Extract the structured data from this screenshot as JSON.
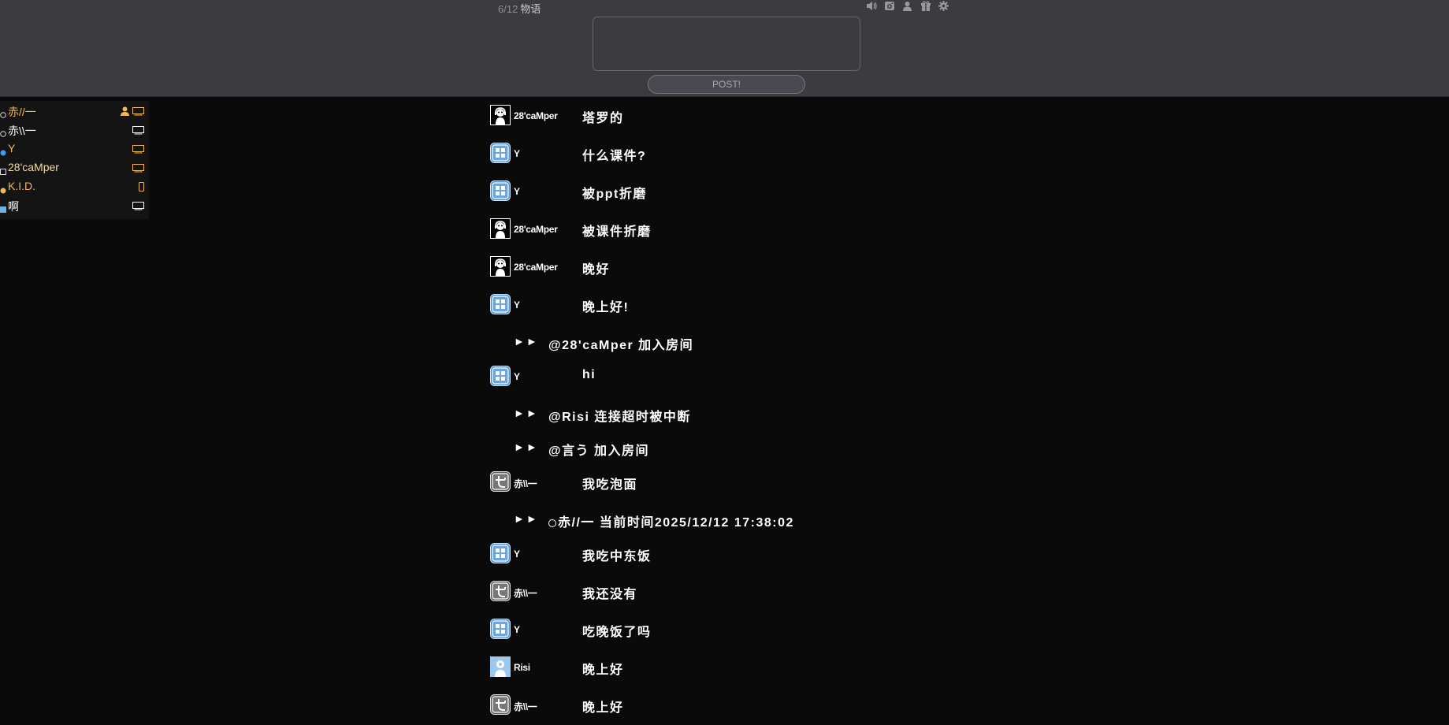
{
  "room": {
    "count": "6/12",
    "name": "物语"
  },
  "composer": {
    "placeholder": "",
    "post_label": "POST!"
  },
  "top_icons": [
    "speaker-icon",
    "camera-icon",
    "person-icon",
    "gift-icon",
    "gear-icon"
  ],
  "users": [
    {
      "name": "赤//一",
      "color": "#f2b857",
      "mark": "ring",
      "icons": [
        "user-host-icon",
        "monitor-icon"
      ]
    },
    {
      "name": "赤\\\\一",
      "color": "#ffffff",
      "mark": "ring",
      "icons": [
        "monitor-icon"
      ]
    },
    {
      "name": "Y",
      "color": "#f2b857",
      "mark": "dot-blue",
      "icons": [
        "monitor-icon"
      ]
    },
    {
      "name": "28'caMper",
      "color": "#f1d9a6",
      "mark": "square",
      "icons": [
        "monitor-icon"
      ]
    },
    {
      "name": "K.I.D.",
      "color": "#f2b857",
      "mark": "dot-orange",
      "icons": [
        "phone-icon"
      ]
    },
    {
      "name": "啊",
      "color": "#ffffff",
      "mark": "square-blue",
      "icons": [
        "monitor-icon"
      ]
    }
  ],
  "messages": [
    {
      "type": "msg",
      "avatar": "camper",
      "sender": "28'caMper",
      "text": "塔罗的"
    },
    {
      "type": "msg",
      "avatar": "grid",
      "sender": "Y",
      "text": "什么课件?"
    },
    {
      "type": "msg",
      "avatar": "grid",
      "sender": "Y",
      "text": "被ppt折磨"
    },
    {
      "type": "msg",
      "avatar": "camper",
      "sender": "28'caMper",
      "text": "被课件折磨"
    },
    {
      "type": "msg",
      "avatar": "camper",
      "sender": "28'caMper",
      "text": "晚好"
    },
    {
      "type": "msg",
      "avatar": "grid",
      "sender": "Y",
      "text": "晚上好!"
    },
    {
      "type": "sys",
      "arrow": "►►",
      "text": "@28'caMper 加入房间"
    },
    {
      "type": "msg",
      "avatar": "grid",
      "sender": "Y",
      "text": "hi"
    },
    {
      "type": "sys",
      "arrow": "►►",
      "text": "@Risi 连接超时被中断"
    },
    {
      "type": "sys",
      "arrow": "►►",
      "text": "@言う 加入房间"
    },
    {
      "type": "msg",
      "avatar": "se",
      "sender": "赤\\\\一",
      "text": "我吃泡面"
    },
    {
      "type": "sys",
      "arrow": "►►",
      "ring": true,
      "text": "赤//一 当前时间2025/12/12 17:38:02"
    },
    {
      "type": "msg",
      "avatar": "grid",
      "sender": "Y",
      "text": "我吃中东饭"
    },
    {
      "type": "msg",
      "avatar": "se",
      "sender": "赤\\\\一",
      "text": "我还没有"
    },
    {
      "type": "msg",
      "avatar": "grid",
      "sender": "Y",
      "text": "吃晚饭了吗"
    },
    {
      "type": "msg",
      "avatar": "risi",
      "sender": "Risi",
      "text": "晚上好"
    },
    {
      "type": "msg",
      "avatar": "se",
      "sender": "赤\\\\一",
      "text": "晚上好"
    }
  ]
}
